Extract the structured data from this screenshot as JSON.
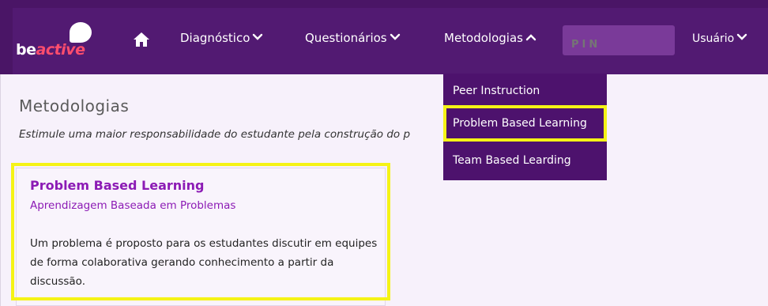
{
  "navbar": {
    "logo": {
      "be": "be",
      "active": "active"
    },
    "home_icon": "home-icon",
    "items": [
      {
        "label": "Diagnóstico",
        "icon": "chevron-down-icon"
      },
      {
        "label": "Questionários",
        "icon": "chevron-down-icon"
      },
      {
        "label": "Metodologias",
        "icon": "chevron-up-icon"
      }
    ],
    "pin_placeholder": "PIN",
    "user": {
      "label": "Usuário",
      "icon": "chevron-down-icon"
    }
  },
  "dropdown": {
    "items": [
      {
        "label": "Peer Instruction",
        "highlighted": false
      },
      {
        "label": "Problem Based Learning",
        "highlighted": true
      },
      {
        "label": "Team Based Learding",
        "highlighted": false
      }
    ]
  },
  "page": {
    "title": "Metodologias",
    "subtitle": "Estimule uma maior responsabilidade do estudante pela construção do p"
  },
  "card": {
    "title": "Problem Based Learning",
    "subtitle": "Aprendizagem Baseada em Problemas",
    "description": "Um problema é proposto para os estudantes discutir em equipes de forma colaborativa gerando conhecimento a partir da discussão."
  },
  "colors": {
    "navbar": "#521a72",
    "accent": "#8c1bb5",
    "highlight": "#f5f316",
    "content_bg": "#f7f1fb"
  }
}
